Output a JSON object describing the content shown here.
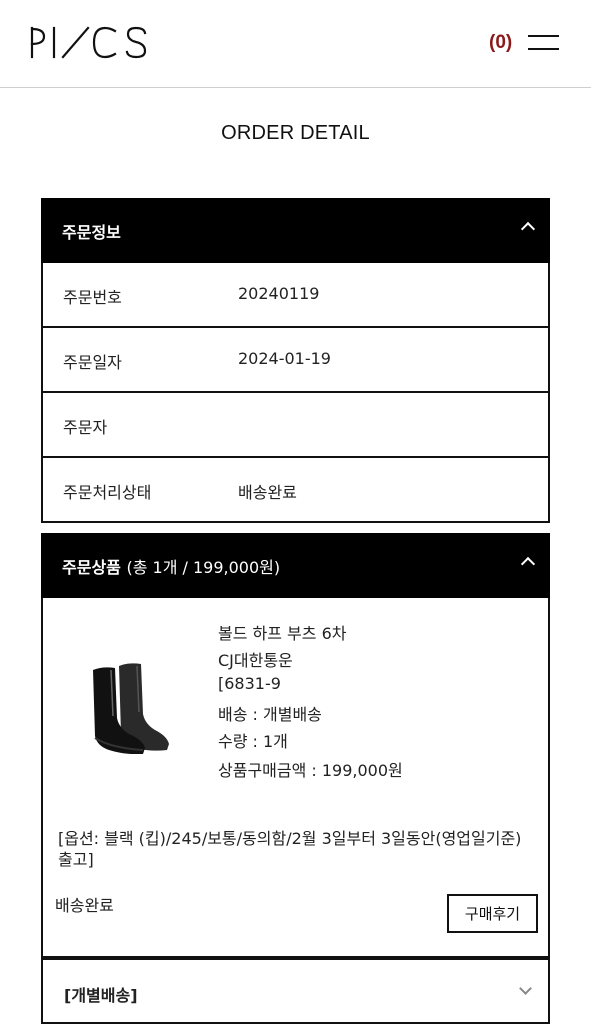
{
  "header": {
    "logo_text": "PI/CS",
    "cart_count": "(0)",
    "menu_icon": "hamburger-icon"
  },
  "page": {
    "title": "ORDER DETAIL"
  },
  "order_info": {
    "heading": "주문정보",
    "rows": [
      {
        "label": "주문번호",
        "value": "20240119"
      },
      {
        "label": "주문일자",
        "value": "2024-01-19"
      },
      {
        "label": "주문자",
        "value": ""
      },
      {
        "label": "주문처리상태",
        "value": "배송완료"
      }
    ]
  },
  "order_items": {
    "heading": "주문상품",
    "heading_sub": "(총 1개 / 199,000원)",
    "product": {
      "name": "볼드 하프 부츠 6차",
      "carrier": "CJ대한통운",
      "tracking": "[6831-9",
      "shipping": "배송 : 개별배송",
      "quantity": "수량 : 1개",
      "amount": "상품구매금액 : 199,000원",
      "option": "[옵션: 블랙 (킵)/245/보통/동의함/2월 3일부터 3일동안(영업일기준) 출고]",
      "status": "배송완료",
      "review_label": "구매후기"
    },
    "shipping_group": "[개별배송]"
  }
}
